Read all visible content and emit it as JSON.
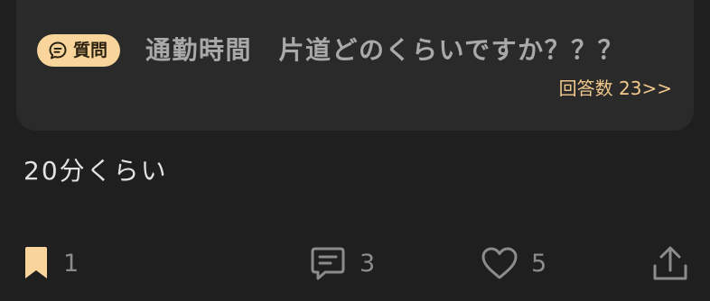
{
  "question": {
    "badge_icon": "chat-bubble-icon",
    "badge_label": "質問",
    "title": "通勤時間　片道どのくらいですか？？？",
    "answer_count": "回答数 23>>"
  },
  "answer": {
    "text": "20分くらい"
  },
  "actions": {
    "bookmark": {
      "icon": "bookmark-icon",
      "count": "1",
      "color": "#f9d49b"
    },
    "comment": {
      "icon": "comment-icon",
      "count": "3"
    },
    "like": {
      "icon": "heart-icon",
      "count": "5"
    },
    "share": {
      "icon": "share-icon"
    }
  },
  "colors": {
    "background": "#1f1f1f",
    "card": "#2a2a2a",
    "accent": "#f9d49b",
    "link": "#f2c98c"
  }
}
